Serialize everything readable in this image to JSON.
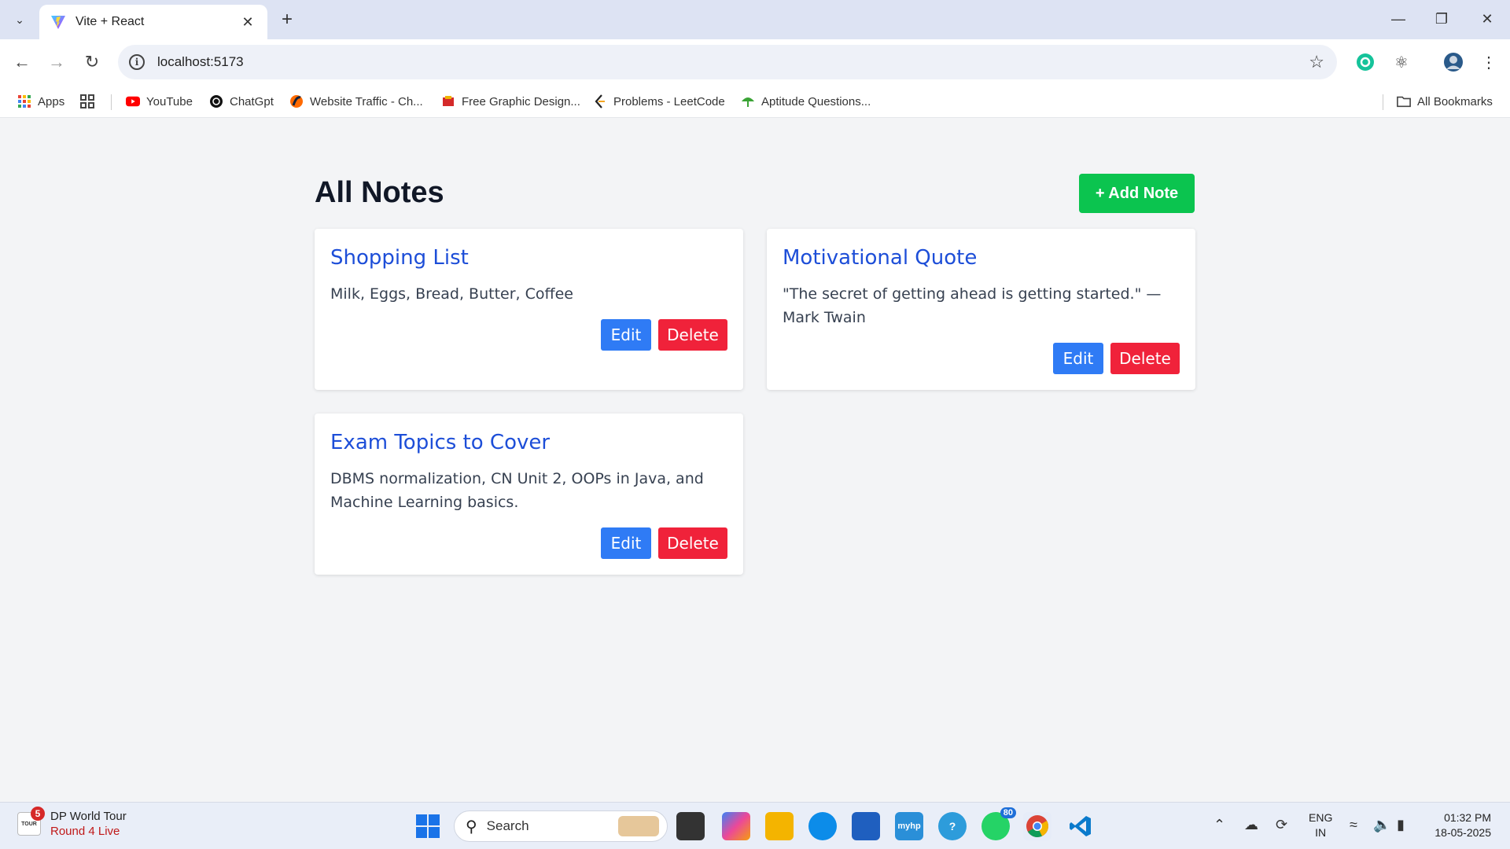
{
  "browser": {
    "tab_title": "Vite + React",
    "new_tab": "+",
    "url": "localhost:5173",
    "bookmarks": [
      {
        "label": "Apps",
        "icon": "apps-grid-icon"
      },
      {
        "label": "YouTube",
        "icon": "youtube-icon"
      },
      {
        "label": "ChatGpt",
        "icon": "chatgpt-icon"
      },
      {
        "label": "Website Traffic - Ch...",
        "icon": "similarweb-icon"
      },
      {
        "label": "Free Graphic Design...",
        "icon": "graphic-design-icon"
      },
      {
        "label": "Problems - LeetCode",
        "icon": "leetcode-icon"
      },
      {
        "label": "Aptitude Questions...",
        "icon": "aptitude-icon"
      }
    ],
    "all_bookmarks": "All Bookmarks"
  },
  "page": {
    "title": "All Notes",
    "add_button": "+ Add Note",
    "edit_label": "Edit",
    "delete_label": "Delete",
    "notes": [
      {
        "title": "Shopping List",
        "body": "Milk, Eggs, Bread, Butter, Coffee"
      },
      {
        "title": "Motivational Quote",
        "body": "\"The secret of getting ahead is getting started.\" — Mark Twain"
      },
      {
        "title": "Exam Topics to Cover",
        "body": "DBMS normalization, CN Unit 2, OOPs in Java, and Machine Learning basics."
      }
    ]
  },
  "taskbar": {
    "widget_badge": "5",
    "widget_line1": "DP World Tour",
    "widget_line2": "Round 4 Live",
    "search_label": "Search",
    "whatsapp_badge": "80",
    "lang_line1": "ENG",
    "lang_line2": "IN",
    "time": "01:32 PM",
    "date": "18-05-2025"
  },
  "colors": {
    "add_button": "#0bc44f",
    "edit_button": "#2f7bf5",
    "delete_button": "#f0223a",
    "note_title": "#1d4ed8"
  }
}
